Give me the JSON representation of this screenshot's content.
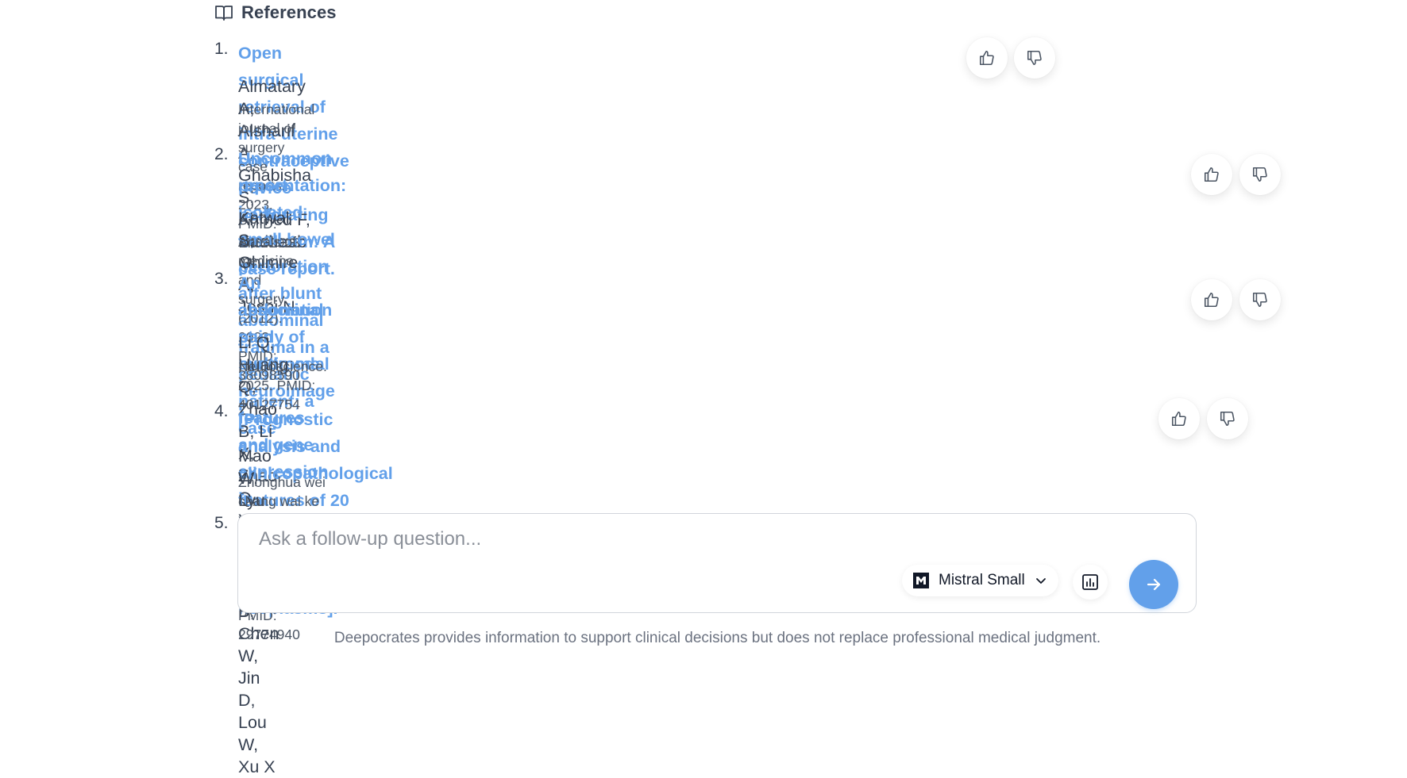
{
  "header": {
    "title": "References",
    "icon": "book-icon"
  },
  "references": [
    {
      "num": "1.",
      "title": "Open surgical retrieval of intra-uterine contraceptive device perforating the ileum: A case report.",
      "authors": "Almatary A, Alsharif A, Ghabisha S, Ahmed F, Badheeb M",
      "journal": "International journal of surgery case reports. 2023. PMID: 37552923"
    },
    {
      "num": "2.",
      "title_line1": "Uncommon presentation: isolated small bowel perforation after blunt abdominal trauma in a pediatric patient; a case",
      "title_line2": "report.",
      "authors": "Katwal S, Ghimire A, Joshi N",
      "journal": "Annals of medicine and surgery (2012). 2023. PMID: 38098590"
    },
    {
      "num": "3.",
      "title_line1": "An association study of multimodal neuroimage features and gene expression in adolescents with centrally mediated",
      "title_line2": "abdominal pain syndrome.",
      "authors": "Li Q, Huang Q, Zhao B, Li X, Zhao Q, Yuan K, Cai S",
      "journal": "Neuroscience. 2025. PMID: 40127754"
    },
    {
      "num": "4.",
      "title": "[Prognostic analysis and clinicopathological features of 20 patients with appendiceal neuroendocrine neoplasms].",
      "authors": "Mao W, Lyu Y, Pu N, Li J, Xin B, Chen W, Jin D, Lou W, Xu X",
      "journal": "Zhonghua wei chang wai ke za zhi = Chinese journal of gastrointestinal surgery. 2018. PMID: 29774940"
    }
  ],
  "list_next_num": "5.",
  "composer": {
    "placeholder": "Ask a follow-up question...",
    "model": "Mistral Small",
    "icons": [
      "mistral-logo-icon",
      "chevron-down-icon",
      "bar-chart-icon",
      "arrow-right-icon"
    ]
  },
  "disclaimer": "Deepocrates provides information to support clinical decisions but does not replace professional medical judgment.",
  "colors": {
    "link": "#62A0EA",
    "text": "#374151",
    "muted": "#6B7280",
    "send": "#62A0EA"
  }
}
